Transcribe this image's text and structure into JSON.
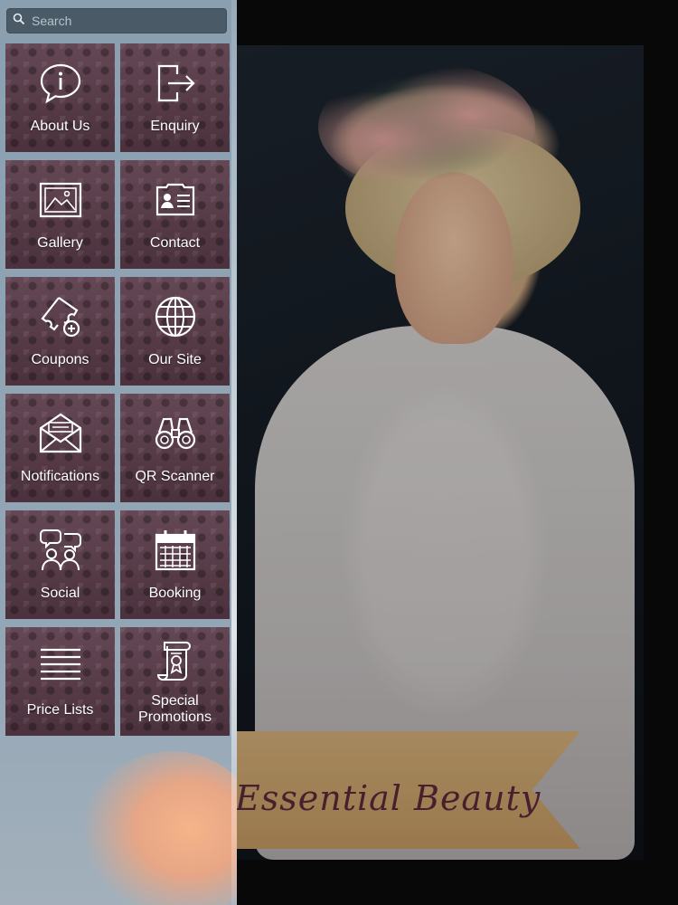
{
  "search": {
    "placeholder": "Search"
  },
  "menu": [
    {
      "label": "About Us",
      "icon": "info-icon"
    },
    {
      "label": "Enquiry",
      "icon": "exit-arrow-icon"
    },
    {
      "label": "Gallery",
      "icon": "image-icon"
    },
    {
      "label": "Contact",
      "icon": "contact-card-icon"
    },
    {
      "label": "Coupons",
      "icon": "coupon-ticket-icon"
    },
    {
      "label": "Our Site",
      "icon": "globe-icon"
    },
    {
      "label": "Notifications",
      "icon": "envelope-icon"
    },
    {
      "label": "QR Scanner",
      "icon": "binoculars-icon"
    },
    {
      "label": "Social",
      "icon": "people-chat-icon"
    },
    {
      "label": "Booking",
      "icon": "calendar-icon"
    },
    {
      "label": "Price Lists",
      "icon": "list-lines-icon"
    },
    {
      "label": "Special Promotions",
      "label_line1": "Special",
      "label_line2": "Promotions",
      "icon": "scroll-award-icon"
    }
  ],
  "banner": {
    "text": "Essential Beauty"
  },
  "colors": {
    "tile": "#5b3c4a",
    "panel": "#8aa0b0",
    "search_bg": "#4a5a66"
  }
}
